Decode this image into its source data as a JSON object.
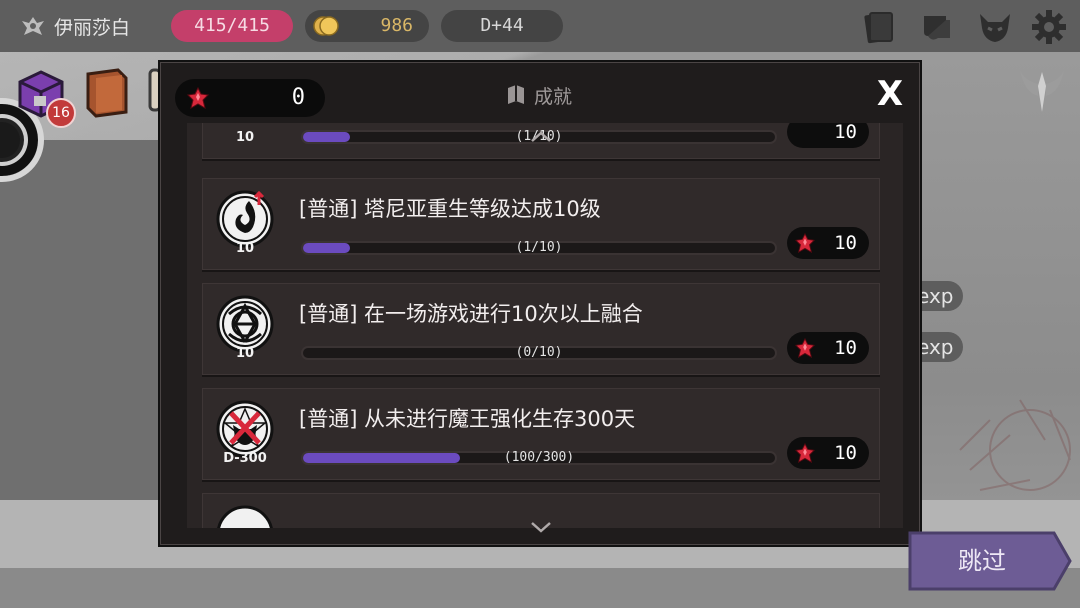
{
  "hud": {
    "player_name": "伊丽莎白",
    "hp": "415/415",
    "gold": "986",
    "day": "D+44",
    "colors": {
      "hp_pill": "#c43f6a",
      "gold_text": "#d9b767"
    }
  },
  "left_items": {
    "chest_badge": "16"
  },
  "background": {
    "exp_label_1": "exp",
    "exp_label_2": "exp"
  },
  "dialog": {
    "title": "成就",
    "gem_count": "0",
    "close_label": "X",
    "achievements": [
      {
        "title": "",
        "medal_label": "10",
        "progress_text": "(1/10)",
        "progress": 0.1,
        "reward": "10",
        "partial": true
      },
      {
        "title": "[普通] 塔尼亚重生等级达成10级",
        "medal_label": "10",
        "progress_text": "(1/10)",
        "progress": 0.1,
        "reward": "10",
        "icon": "flame-rebirth-icon"
      },
      {
        "title": "[普通] 在一场游戏进行10次以上融合",
        "medal_label": "10",
        "progress_text": "(0/10)",
        "progress": 0.0,
        "reward": "10",
        "icon": "fusion-knot-icon"
      },
      {
        "title": "[普通] 从未进行魔王强化生存300天",
        "medal_label": "D-300",
        "progress_text": "(100/300)",
        "progress": 0.3333,
        "reward": "10",
        "icon": "crossed-demon-icon"
      }
    ],
    "colors": {
      "progress_fill": "#6b4bbf",
      "panel": "#1f1c1c"
    }
  },
  "skip_button": {
    "label": "跳过",
    "color": "#6d5c95"
  }
}
